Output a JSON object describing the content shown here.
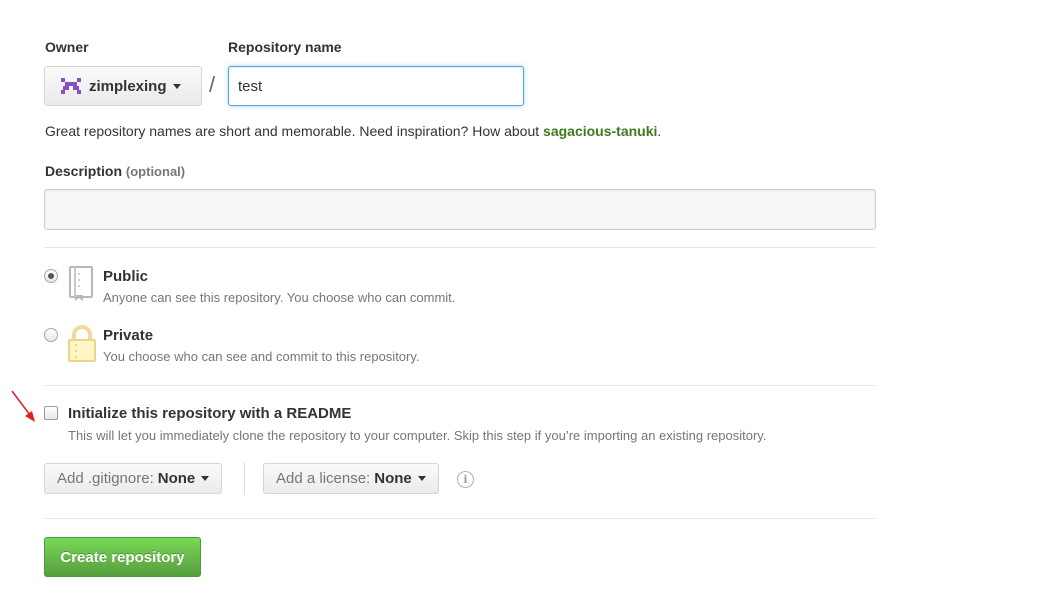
{
  "owner": {
    "label": "Owner",
    "selected": "zimplexing"
  },
  "repository": {
    "label": "Repository name",
    "separator": "/",
    "value": "test"
  },
  "hint": {
    "text": "Great repository names are short and memorable. Need inspiration? How about ",
    "suggestion": "sagacious-tanuki",
    "end": "."
  },
  "description": {
    "label": "Description",
    "optional": "(optional)",
    "value": ""
  },
  "visibility": {
    "selected": "public",
    "options": [
      {
        "title": "Public",
        "desc": "Anyone can see this repository. You choose who can commit.",
        "icon": "book-icon"
      },
      {
        "title": "Private",
        "desc": "You choose who can see and commit to this repository.",
        "icon": "lock-icon"
      }
    ]
  },
  "readme": {
    "checked": false,
    "title": "Initialize this repository with a README",
    "desc": "This will let you immediately clone the repository to your computer. Skip this step if you’re importing an existing repository."
  },
  "gitignore": {
    "prefix": "Add .gitignore:",
    "value": "None"
  },
  "license": {
    "prefix": "Add a license:",
    "value": "None"
  },
  "info_icon": "info-icon",
  "submit": {
    "label": "Create repository"
  },
  "colors": {
    "accent_blue": "#51a7e8",
    "suggestion_green": "#3d7a1e",
    "button_green": "#569e3d",
    "annotation_arrow": "#e02020"
  }
}
